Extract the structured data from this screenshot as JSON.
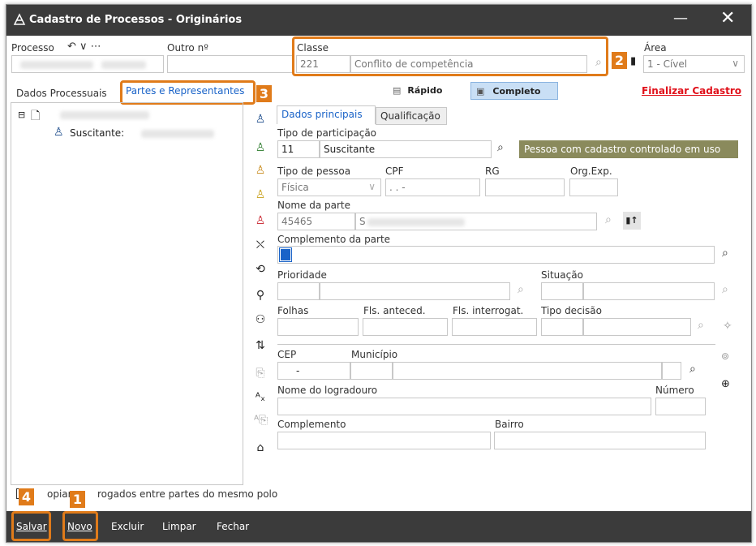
{
  "window": {
    "title": "Cadastro de Processos - Originários",
    "minimize": "—",
    "close": "✕"
  },
  "header": {
    "processo_label": "Processo",
    "processo_icons": "↶ ∨ ⋯",
    "outro_label": "Outro nº",
    "classe_label": "Classe",
    "classe_code": "221",
    "classe_name": "Conflito de competência",
    "area_label": "Área",
    "area_value": "1 - Cível"
  },
  "tabs": {
    "dados_processuais": "Dados Processuais",
    "partes": "Partes e Representantes",
    "rapido": "Rápido",
    "completo": "Completo",
    "finalizar": "Finalizar Cadastro"
  },
  "tree": {
    "child_label": "Suscitante:"
  },
  "subtabs": {
    "principais": "Dados principais",
    "qualificacao": "Qualificação"
  },
  "form": {
    "tipo_participacao_label": "Tipo de participação",
    "tipo_participacao_code": "11",
    "tipo_participacao_value": "Suscitante",
    "pessoa_controlada_btn": "Pessoa com cadastro controlado em uso",
    "tipo_pessoa_label": "Tipo de pessoa",
    "tipo_pessoa_value": "Física",
    "cpf_label": "CPF",
    "cpf_value": ". . -",
    "rg_label": "RG",
    "orgexp_label": "Org.Exp.",
    "nome_parte_label": "Nome da parte",
    "nome_parte_code": "45465",
    "nome_parte_initial": "S",
    "complemento_parte_label": "Complemento da parte",
    "prioridade_label": "Prioridade",
    "situacao_label": "Situação",
    "folhas_label": "Folhas",
    "fls_anteced_label": "Fls. anteced.",
    "fls_interrogat_label": "Fls. interrogat.",
    "tipo_decisao_label": "Tipo decisão",
    "cep_label": "CEP",
    "cep_value": "-",
    "municipio_label": "Município",
    "logradouro_label": "Nome do logradouro",
    "numero_label": "Número",
    "complemento_label": "Complemento",
    "bairro_label": "Bairro"
  },
  "checkbox": {
    "label_start": "opiar",
    "label_end": "rogados entre partes do mesmo polo"
  },
  "bottombar": {
    "salvar": "Salvar",
    "novo": "Novo",
    "excluir": "Excluir",
    "limpar": "Limpar",
    "fechar": "Fechar"
  },
  "badges": {
    "b1": "1",
    "b2": "2",
    "b3": "3",
    "b4": "4"
  },
  "colors": {
    "titlebar": "#3b3b3b",
    "accent_orange": "#e07b1a",
    "link_blue": "#1a63c8",
    "finalizar_red": "#e0101a",
    "olive": "#8a8a5c"
  }
}
